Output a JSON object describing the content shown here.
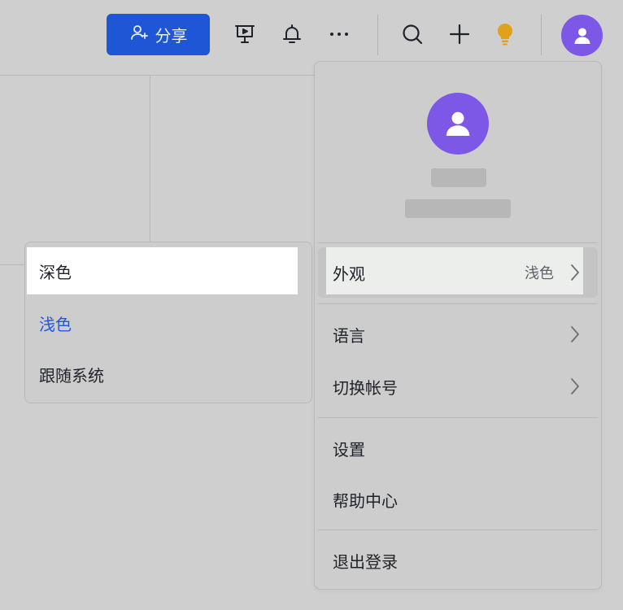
{
  "toolbar": {
    "share_label": "分享",
    "icons": [
      "present-icon",
      "bell-icon",
      "more-icon",
      "search-icon",
      "plus-icon",
      "lightbulb-icon"
    ],
    "accent_color": "#1f56d6",
    "avatar_color": "#7d57e6",
    "bulb_color": "#e0a21a"
  },
  "account_menu": {
    "items": [
      {
        "label": "外观",
        "value": "浅色",
        "has_arrow": true
      },
      {
        "label": "语言",
        "has_arrow": true
      },
      {
        "label": "切换帐号",
        "has_arrow": true
      },
      {
        "label": "设置"
      },
      {
        "label": "帮助中心"
      },
      {
        "label": "退出登录"
      }
    ]
  },
  "appearance_menu": {
    "options": [
      {
        "label": "深色",
        "state": "hovered"
      },
      {
        "label": "浅色",
        "state": "selected"
      },
      {
        "label": "跟随系统",
        "state": "normal"
      }
    ],
    "selected_color": "#2457d6"
  }
}
